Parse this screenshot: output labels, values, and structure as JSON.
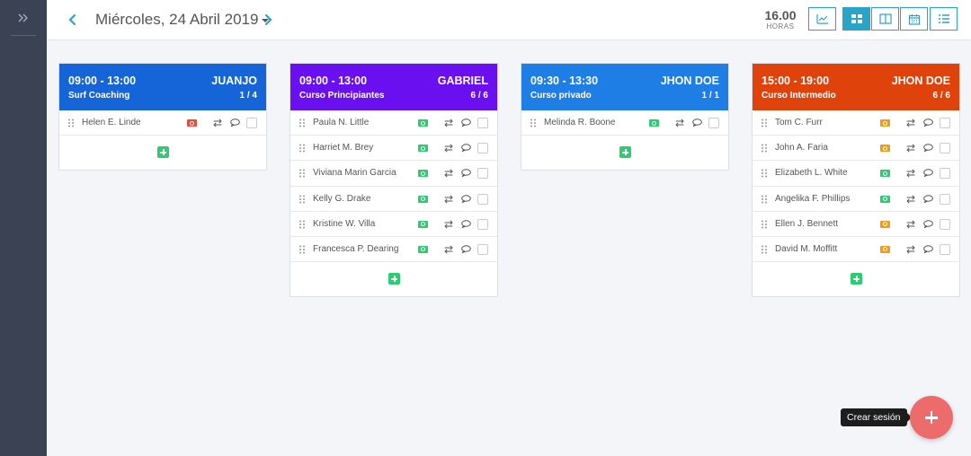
{
  "header": {
    "date_label": "Miércoles, 24 Abril 2019",
    "hours_value": "16.00",
    "hours_label": "HORAS"
  },
  "colors": {
    "accent": "#2aa3c9",
    "add_green": "#2ecc71",
    "fab": "#ec6b6b"
  },
  "sessions": [
    {
      "time": "09:00 - 13:00",
      "instructor": "JUANJO",
      "course": "Surf Coaching",
      "count": "1 / 4",
      "color": "#1565d8",
      "students": [
        {
          "name": "Helen E. Linde",
          "payment": "red"
        }
      ]
    },
    {
      "time": "09:00 - 13:00",
      "instructor": "GABRIEL",
      "course": "Curso Principiantes",
      "count": "6 / 6",
      "color": "#6a10f0",
      "students": [
        {
          "name": "Paula N. Little",
          "payment": "green"
        },
        {
          "name": "Harriet M. Brey",
          "payment": "green"
        },
        {
          "name": "Viviana Marin Garcia",
          "payment": "green"
        },
        {
          "name": "Kelly G. Drake",
          "payment": "green"
        },
        {
          "name": "Kristine W. Villa",
          "payment": "green"
        },
        {
          "name": "Francesca P. Dearing",
          "payment": "green"
        }
      ]
    },
    {
      "time": "09:30 - 13:30",
      "instructor": "JHON DOE",
      "course": "Curso privado",
      "count": "1 / 1",
      "color": "#1e7ee6",
      "students": [
        {
          "name": "Melinda R. Boone",
          "payment": "green"
        }
      ]
    },
    {
      "time": "15:00 - 19:00",
      "instructor": "JHON DOE",
      "course": "Curso Intermedio",
      "count": "6 / 6",
      "color": "#e0420c",
      "students": [
        {
          "name": "Tom C. Furr",
          "payment": "orange"
        },
        {
          "name": "John A. Faria",
          "payment": "orange"
        },
        {
          "name": "Elizabeth L. White",
          "payment": "green"
        },
        {
          "name": "Angelika F. Phillips",
          "payment": "green"
        },
        {
          "name": "Ellen J. Bennett",
          "payment": "orange"
        },
        {
          "name": "David M. Moffitt",
          "payment": "orange"
        }
      ]
    }
  ],
  "fab": {
    "tooltip": "Crear sesión"
  }
}
